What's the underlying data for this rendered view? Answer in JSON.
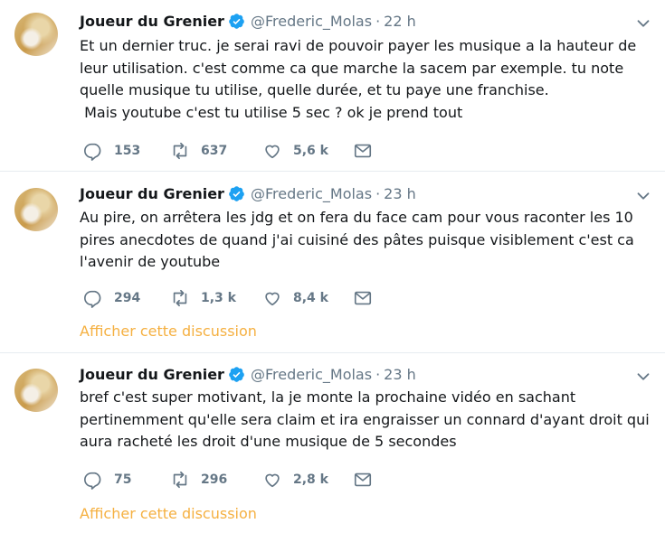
{
  "tweets": [
    {
      "name": "Joueur du Grenier",
      "handle": "@Frederic_Molas",
      "dot": "·",
      "time": "22 h",
      "text": "Et un dernier truc. je serai ravi de pouvoir payer les musique a la hauteur de leur utilisation. c'est comme ca que marche la sacem par exemple. tu note quelle musique tu utilise, quelle durée, et tu paye une franchise.\n Mais youtube c'est tu utilise 5 sec ? ok je prend tout",
      "replies": "153",
      "retweets": "637",
      "likes": "5,6 k"
    },
    {
      "name": "Joueur du Grenier",
      "handle": "@Frederic_Molas",
      "dot": "·",
      "time": "23 h",
      "text": "Au pire, on arrêtera les jdg et on fera du face cam pour vous raconter les 10 pires anecdotes de quand j'ai cuisiné des pâtes puisque visiblement c'est ca l'avenir de youtube",
      "replies": "294",
      "retweets": "1,3 k",
      "likes": "8,4 k",
      "thread_link": "Afficher cette discussion"
    },
    {
      "name": "Joueur du Grenier",
      "handle": "@Frederic_Molas",
      "dot": "·",
      "time": "23 h",
      "text": "bref c'est super motivant, la je monte la prochaine vidéo en sachant pertinemment qu'elle sera claim et ira engraisser un connard d'ayant droit qui aura racheté les droit d'une musique de 5 secondes",
      "replies": "75",
      "retweets": "296",
      "likes": "2,8 k",
      "thread_link": "Afficher cette discussion"
    }
  ],
  "icons": {
    "verified": "verified-badge-icon",
    "chevron": "chevron-down-icon",
    "reply": "reply-icon",
    "retweet": "retweet-icon",
    "like": "heart-icon",
    "dm": "envelope-icon"
  },
  "colors": {
    "text": "#14171a",
    "secondary": "#657786",
    "verified": "#1da1f2",
    "link": "#f5b041",
    "divider": "#e6ecf0"
  }
}
